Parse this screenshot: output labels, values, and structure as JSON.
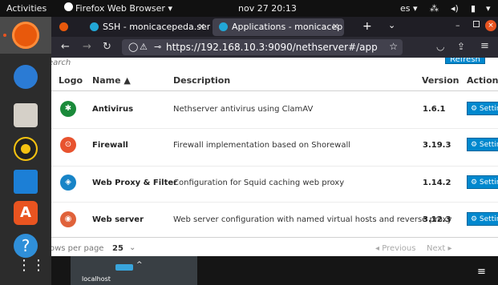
{
  "topbar": {
    "activities": "Activities",
    "app_menu": "Firefox Web Browser ▾",
    "clock": "nov 27  20:13",
    "keyboard_layout": "es ▾",
    "network_icon": "network-icon",
    "volume_icon": "volume-icon",
    "battery_icon": "battery-icon",
    "system_menu_icon": "caret-down-icon"
  },
  "dock": {
    "items": [
      "firefox-icon",
      "thunderbird-icon",
      "files-icon",
      "rhythmbox-icon",
      "writer-icon",
      "software-icon",
      "help-icon",
      "show-apps-icon"
    ],
    "store_glyph": "A",
    "help_glyph": "?",
    "apps_glyph": "⋮⋮"
  },
  "browser": {
    "tabs": [
      {
        "label": "SSH - monicacepeda.serv",
        "close": "×"
      },
      {
        "label": "Applications - monicacep",
        "close": "×"
      }
    ],
    "new_tab": "+",
    "tab_list": "⌄",
    "window_min": "–",
    "window_close": "×",
    "url_host": "https://192.168.10.3",
    "url_rest": ":9090/nethserver#/app"
  },
  "page": {
    "search_placeholder": "earch",
    "refresh_label": "Refresh",
    "columns": {
      "logo": "Logo",
      "name": "Name ▲",
      "description": "Description",
      "version": "Version",
      "action": "Action"
    },
    "rows": [
      {
        "name": "Antivirus",
        "description": "Nethserver antivirus using ClamAV",
        "version": "1.6.1",
        "action": "⚙ Settings",
        "logo_color": "#1a8a3a",
        "logo_glyph": "✱"
      },
      {
        "name": "Firewall",
        "description": "Firewall implementation based on Shorewall",
        "version": "3.19.3",
        "action": "⚙ Settings",
        "logo_color": "#e8532f",
        "logo_glyph": "⊙"
      },
      {
        "name": "Web Proxy & Filter",
        "description": "Configuration for Squid caching web proxy",
        "version": "1.14.2",
        "action": "⚙ Settings",
        "logo_color": "#1784c7",
        "logo_glyph": "◈"
      },
      {
        "name": "Web server",
        "description": "Web server configuration with named virtual hosts and reverse proxy",
        "version": "3.12.3",
        "action": "⚙ Settings",
        "logo_color": "#e0623a",
        "logo_glyph": "◉"
      }
    ],
    "pagination": {
      "rows_per_page_label": "ows per page",
      "rows_per_page_value": "25",
      "rows_caret": "⌄",
      "previous": "◂ Previous",
      "next": "Next ▸"
    }
  },
  "bottombar": {
    "host_label": "localhost",
    "host_caret": "^",
    "menu_glyph": "≡"
  }
}
